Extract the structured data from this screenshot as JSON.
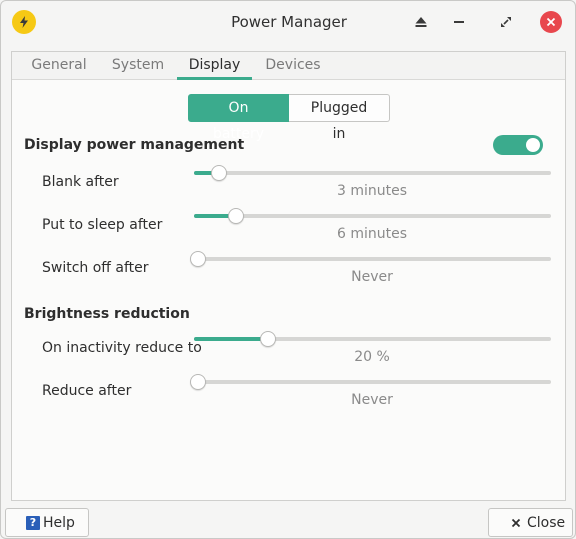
{
  "window": {
    "title": "Power Manager",
    "icons": {
      "app": "lightning-bolt-icon",
      "eject": "eject-icon",
      "minimize": "minimize-icon",
      "maximize": "maximize-icon",
      "close": "close-icon"
    }
  },
  "tabs": [
    {
      "label": "General",
      "active": false
    },
    {
      "label": "System",
      "active": false
    },
    {
      "label": "Display",
      "active": true
    },
    {
      "label": "Devices",
      "active": false
    }
  ],
  "segmented": {
    "on_battery": "On battery",
    "plugged_in": "Plugged in",
    "selected": "On battery"
  },
  "display_power": {
    "title": "Display power management",
    "enabled": true,
    "rows": [
      {
        "label": "Blank after",
        "value_text": "3 minutes",
        "level": 0.06
      },
      {
        "label": "Put to sleep after",
        "value_text": "6 minutes",
        "level": 0.108
      },
      {
        "label": "Switch off after",
        "value_text": "Never",
        "level": 0.0
      }
    ]
  },
  "brightness": {
    "title": "Brightness reduction",
    "rows": [
      {
        "label": "On inactivity reduce to",
        "value_text": "20 %",
        "level": 0.2
      },
      {
        "label": "Reduce after",
        "value_text": "Never",
        "level": 0.0
      }
    ]
  },
  "footer": {
    "help": "Help",
    "close": "Close"
  },
  "colors": {
    "accent": "#3bab8d",
    "close_button": "#e8474d",
    "app_icon": "#f6c915",
    "help_icon": "#2a5fb8"
  }
}
